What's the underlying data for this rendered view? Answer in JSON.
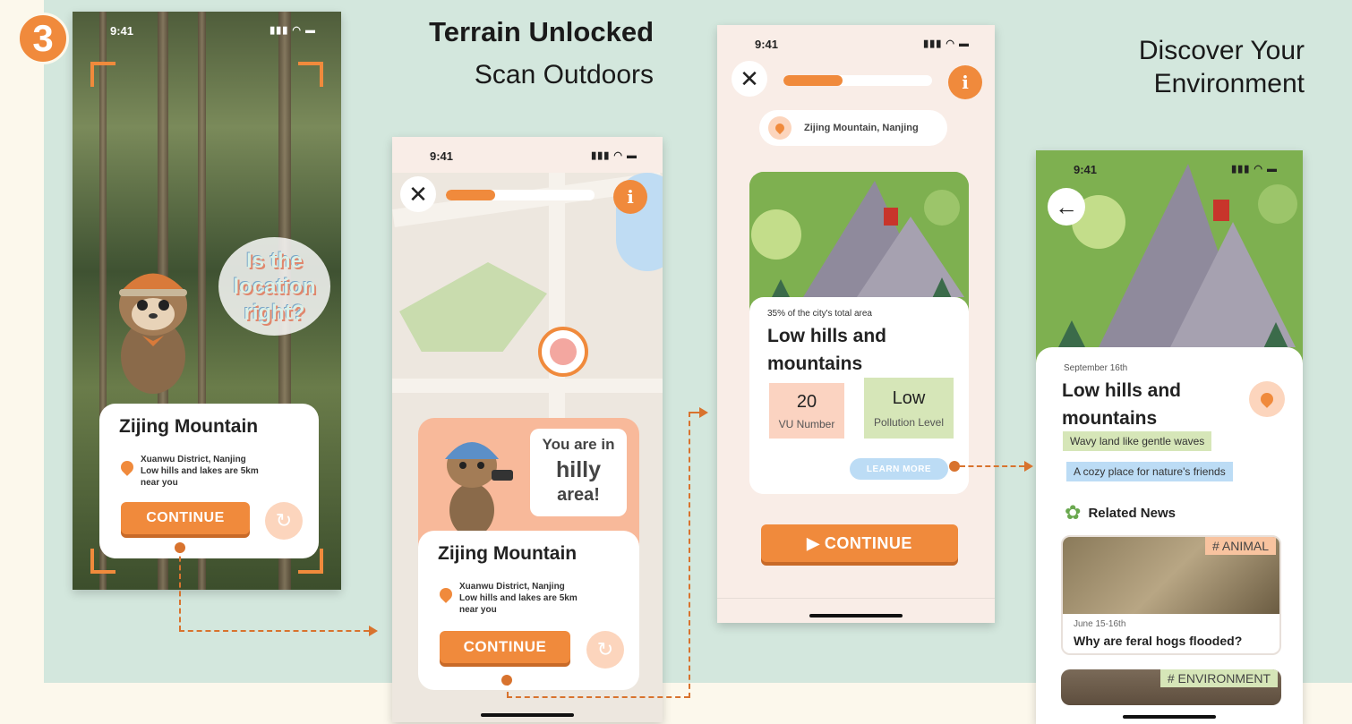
{
  "step_number": "3",
  "captions": {
    "terrain_title": "Terrain Unlocked",
    "terrain_sub": "Scan Outdoors",
    "discover_line1": "Discover Your",
    "discover_line2": "Environment"
  },
  "status_bar": {
    "time": "9:41",
    "signal": "▮▮▮ ◠ ▬"
  },
  "screen1": {
    "speech_line1": "Is the",
    "speech_line2": "location",
    "speech_line3": "right?",
    "card_title": "Zijing Mountain",
    "address_line1": "Xuanwu District, Nanjing",
    "address_line2": "Low hills and lakes are 5km",
    "address_line3": "near you",
    "continue_label": "CONTINUE",
    "refresh_icon": "↻"
  },
  "screen2": {
    "close_icon": "✕",
    "info_icon": "i",
    "progress": 0.33,
    "bubble_line1": "You are in",
    "bubble_line2": "hilly",
    "bubble_line3": "area!",
    "card_title": "Zijing Mountain",
    "address_line1": "Xuanwu District, Nanjing",
    "address_line2": "Low hills and lakes are 5km",
    "address_line3": "near you",
    "continue_label": "CONTINUE",
    "refresh_icon": "↻"
  },
  "screen3": {
    "close_icon": "✕",
    "info_icon": "i",
    "progress": 0.4,
    "location": "Zijing Mountain, Nanjing",
    "area_note": "35% of the city's total area",
    "terrain_line1": "Low hills and",
    "terrain_line2": "mountains",
    "vu_value": "20",
    "vu_label": "VU Number",
    "pollution_value": "Low",
    "pollution_label": "Pollution Level",
    "learn_more": "LEARN MORE",
    "continue_label": "▶ CONTINUE"
  },
  "screen4": {
    "back_icon": "←",
    "date": "September 16th",
    "title_line1": "Low hills and",
    "title_line2": "mountains",
    "tag1": "Wavy land like gentle waves",
    "tag2": "A cozy place for nature's friends",
    "related_news": "Related News",
    "news1_tag": "# ANIMAL",
    "news1_date": "June 15-16th",
    "news1_title": "Why are feral hogs flooded?",
    "news2_tag": "# ENVIRONMENT"
  },
  "colors": {
    "accent": "#f08a3c",
    "panel_bg": "#d3e7dd",
    "page_bg": "#fcf8ec"
  }
}
